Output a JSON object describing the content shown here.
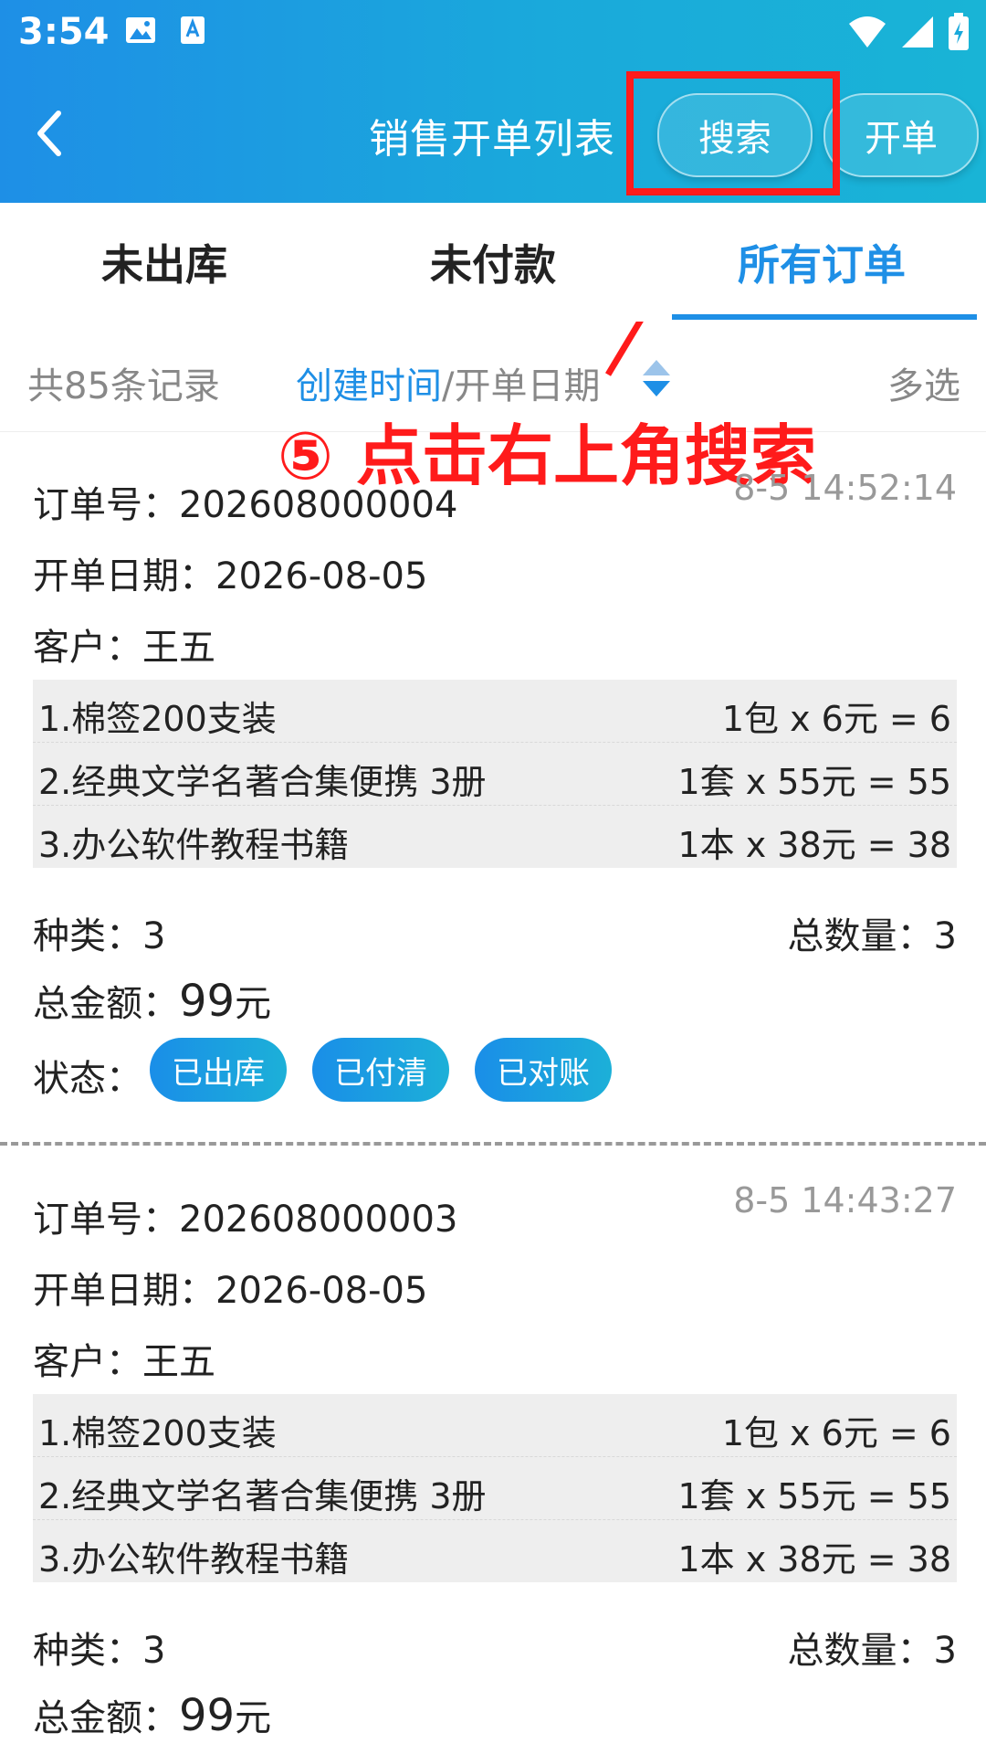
{
  "status_bar": {
    "time": "3:54"
  },
  "header": {
    "title": "销售开单列表",
    "search_label": "搜索",
    "open_label": "开单"
  },
  "annotation": {
    "text": "⑤ 点击右上角搜索"
  },
  "tabs": [
    {
      "label": "未出库"
    },
    {
      "label": "未付款"
    },
    {
      "label": "所有订单"
    }
  ],
  "sortbar": {
    "total": "共85条记录",
    "sort_active": "创建时间",
    "sort_rest": "/开单日期",
    "multi": "多选"
  },
  "orders": [
    {
      "order_no": "订单号：202608000004",
      "time": "8-5 14:52:14",
      "date": "开单日期：2026-08-05",
      "customer": "客户：王五",
      "items": [
        {
          "name": "1.棉签200支装",
          "calc": "1包 x 6元 = 6"
        },
        {
          "name": "2.经典文学名著合集便携 3册",
          "calc": "1套 x 55元 = 55"
        },
        {
          "name": "3.办公软件教程书籍",
          "calc": "1本 x 38元 = 38"
        }
      ],
      "kinds": "种类：3",
      "qty": "总数量：3",
      "amount_label": "总金额：",
      "amount_value": "99",
      "amount_unit": "元",
      "status_label": "状态：",
      "badges": [
        "已出库",
        "已付清",
        "已对账"
      ]
    },
    {
      "order_no": "订单号：202608000003",
      "time": "8-5 14:43:27",
      "date": "开单日期：2026-08-05",
      "customer": "客户：王五",
      "items": [
        {
          "name": "1.棉签200支装",
          "calc": "1包 x 6元 = 6"
        },
        {
          "name": "2.经典文学名著合集便携 3册",
          "calc": "1套 x 55元 = 55"
        },
        {
          "name": "3.办公软件教程书籍",
          "calc": "1本 x 38元 = 38"
        }
      ],
      "kinds": "种类：3",
      "qty": "总数量：3",
      "amount_label": "总金额：",
      "amount_value": "99",
      "amount_unit": "元"
    }
  ],
  "colors": {
    "accent": "#1e8fe6",
    "annotation": "#ff1b1b"
  },
  "icons": {
    "back": "chevron-left-icon",
    "sort": "sort-updown-icon",
    "wifi": "wifi-icon",
    "signal": "signal-icon",
    "battery": "battery-icon"
  }
}
